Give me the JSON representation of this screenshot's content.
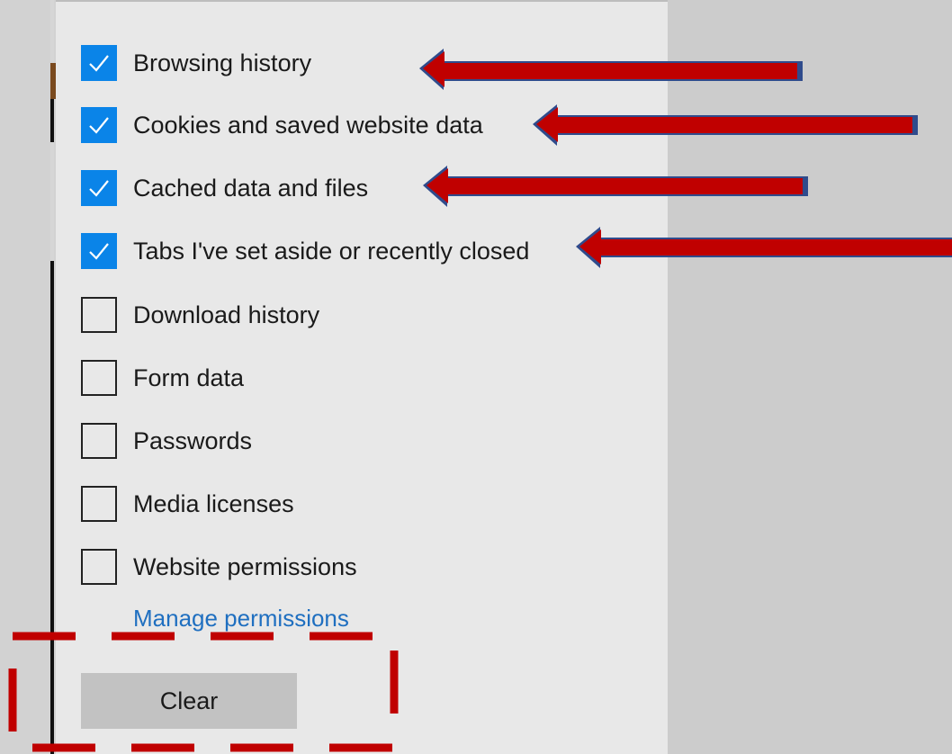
{
  "options": [
    {
      "label": "Browsing history",
      "checked": true
    },
    {
      "label": "Cookies and saved website data",
      "checked": true
    },
    {
      "label": "Cached data and files",
      "checked": true
    },
    {
      "label": "Tabs I've set aside or recently closed",
      "checked": true
    },
    {
      "label": "Download history",
      "checked": false
    },
    {
      "label": "Form data",
      "checked": false
    },
    {
      "label": "Passwords",
      "checked": false
    },
    {
      "label": "Media licenses",
      "checked": false
    },
    {
      "label": "Website permissions",
      "checked": false
    }
  ],
  "manage_link": "Manage permissions",
  "clear_button": "Clear",
  "colors": {
    "checkbox_checked": "#0a84e8",
    "link": "#1f6fc0",
    "annotation_red": "#c00000",
    "annotation_outline": "#2f4b8c"
  },
  "icons": {
    "check": "check-icon"
  }
}
